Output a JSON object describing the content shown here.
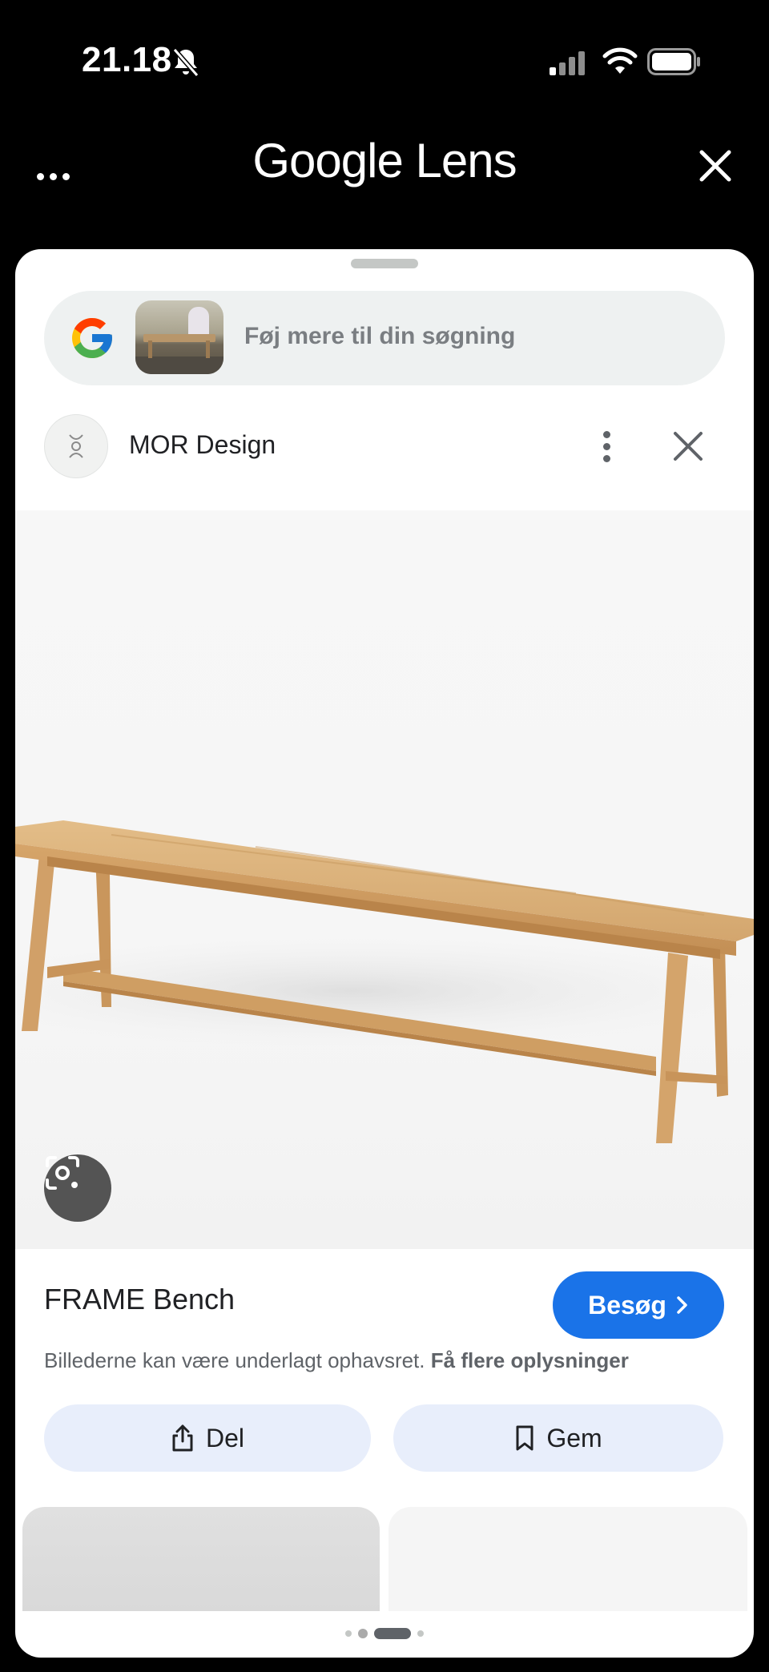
{
  "status_bar": {
    "time": "21.18"
  },
  "header": {
    "title": "Google Lens"
  },
  "search": {
    "placeholder": "Føj mere til din søgning"
  },
  "source": {
    "name": "MOR Design"
  },
  "product": {
    "title": "FRAME Bench",
    "visit_label": "Besøg",
    "copyright_text": "Billederne kan være underlagt ophavsret.",
    "copyright_link": "Få flere oplysninger"
  },
  "actions": {
    "share_label": "Del",
    "save_label": "Gem"
  },
  "colors": {
    "accent": "#1a73e8",
    "action_bg": "#e8eefb",
    "wood": "#d9b07a"
  },
  "icons": [
    "more-horizontal-icon",
    "close-icon",
    "google-g-icon",
    "more-vertical-icon",
    "lens-camera-icon",
    "share-icon",
    "bookmark-icon",
    "chevron-right-icon",
    "bell-off-icon",
    "signal-icon",
    "wifi-icon",
    "battery-icon"
  ]
}
